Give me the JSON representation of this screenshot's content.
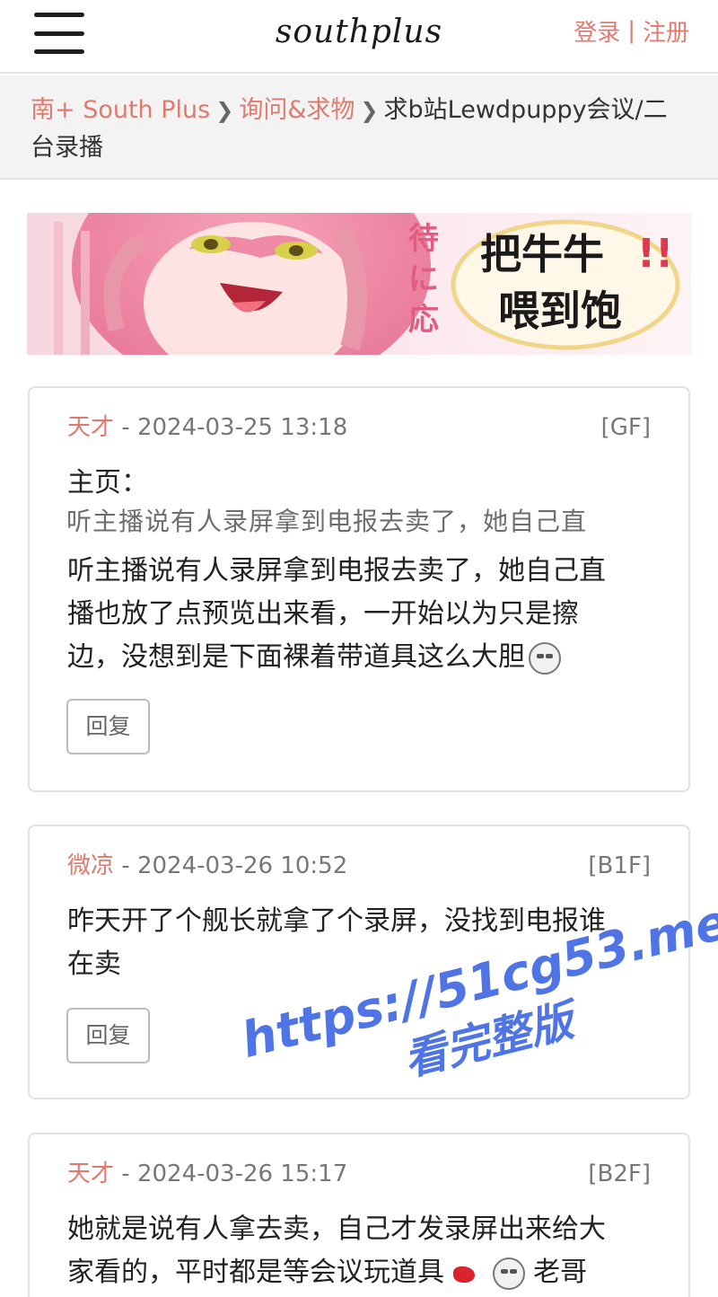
{
  "header": {
    "logo": "southplus",
    "login": "登录",
    "separator": "|",
    "register": "注册"
  },
  "breadcrumb": {
    "items": [
      "南+ South Plus",
      "询问&求物"
    ],
    "current": "求b站Lewdpuppy会议/二台录播"
  },
  "banner": {
    "caption": "把牛牛喂到饱",
    "side_text": "期待に応"
  },
  "overlay_text": "听主播说有人录屏拿到电报去卖了，她自己直",
  "posts": [
    {
      "author": "天才",
      "datetime": "2024-03-25 13:18",
      "floor": "[GF]",
      "lines": [
        "主页：",
        "听主播说有人录屏拿到电报去卖了，她自己直",
        "播也放了点预览出来看，一开始以为只是擦",
        "边，没想到是下面裸着带道具这么大胆"
      ],
      "reply_label": "回复"
    },
    {
      "author": "微凉",
      "datetime": "2024-03-26 10:52",
      "floor": "[B1F]",
      "lines": [
        "昨天开了个舰长就拿了个录屏，没找到电报谁",
        "在卖"
      ],
      "reply_label": "回复"
    },
    {
      "author": "天才",
      "datetime": "2024-03-26 15:17",
      "floor": "[B2F]",
      "lines": [
        "她就是说有人拿去卖，自己才发录屏出来给大",
        "家看的，平时都是等会议玩道具",
        "老哥"
      ]
    }
  ],
  "watermark": {
    "url": "https://51cg53.me",
    "cta": "看完整版"
  },
  "colors": {
    "accent": "#e07a6f",
    "watermark": "#4f74e6",
    "border": "#e3e3e3"
  }
}
